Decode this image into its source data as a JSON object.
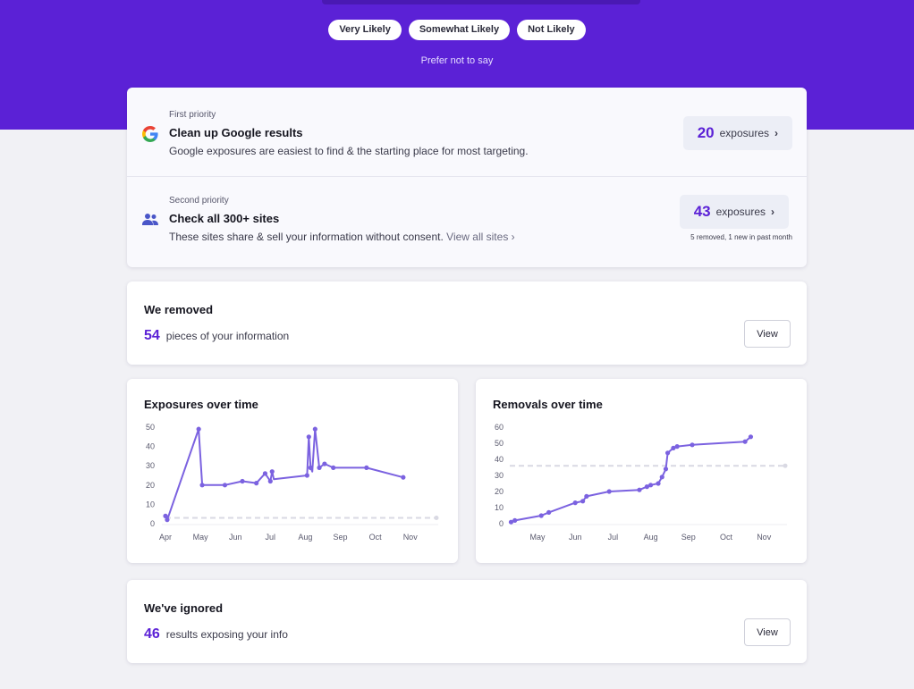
{
  "hero": {
    "options": [
      "Very Likely",
      "Somewhat Likely",
      "Not Likely"
    ],
    "prefer_not": "Prefer not to say"
  },
  "priorities": [
    {
      "label": "First priority",
      "title": "Clean up Google results",
      "description": "Google exposures are easiest to find & the starting place for most targeting.",
      "count": "20",
      "count_label": "exposures",
      "icon": "google-icon"
    },
    {
      "label": "Second priority",
      "title": "Check all 300+ sites",
      "description": "These sites share & sell your information without consent.",
      "link": "View all sites ›",
      "count": "43",
      "count_label": "exposures",
      "note": "5 removed, 1 new in past month",
      "icon": "people-icon"
    }
  ],
  "removed": {
    "title": "We removed",
    "count": "54",
    "text": "pieces of your information",
    "button": "View"
  },
  "ignored": {
    "title": "We've ignored",
    "count": "46",
    "text": "results exposing your info",
    "button": "View"
  },
  "colors": {
    "accent": "#5b21d6",
    "line": "#7b62e0",
    "reference": "#d9d9e3"
  },
  "chart_data": [
    {
      "type": "line",
      "title": "Exposures over time",
      "ylim": [
        0,
        50
      ],
      "yticks": [
        "0",
        "10",
        "20",
        "30",
        "40",
        "50"
      ],
      "months": [
        "Apr",
        "May",
        "Jun",
        "Jul",
        "Aug",
        "Sep",
        "Oct",
        "Nov"
      ],
      "reference_line": 3,
      "points": [
        [
          0,
          4
        ],
        [
          0.05,
          2
        ],
        [
          0.95,
          49
        ],
        [
          1.05,
          20
        ],
        [
          1.7,
          20
        ],
        [
          2.2,
          22
        ],
        [
          2.6,
          21
        ],
        [
          2.85,
          26
        ],
        [
          3.0,
          22
        ],
        [
          3.05,
          27
        ],
        [
          3.1,
          23
        ],
        [
          4.05,
          25
        ],
        [
          4.1,
          45
        ],
        [
          4.15,
          29
        ],
        [
          4.2,
          27
        ],
        [
          4.28,
          49
        ],
        [
          4.4,
          29
        ],
        [
          4.55,
          31
        ],
        [
          4.8,
          29
        ],
        [
          5.75,
          29
        ],
        [
          6.8,
          24
        ]
      ],
      "markers": [
        [
          0,
          4
        ],
        [
          0.05,
          2
        ],
        [
          0.95,
          49
        ],
        [
          1.05,
          20
        ],
        [
          1.7,
          20
        ],
        [
          2.2,
          22
        ],
        [
          2.6,
          21
        ],
        [
          2.85,
          26
        ],
        [
          3.0,
          22
        ],
        [
          3.05,
          27
        ],
        [
          4.05,
          25
        ],
        [
          4.1,
          45
        ],
        [
          4.15,
          29
        ],
        [
          4.28,
          49
        ],
        [
          4.4,
          29
        ],
        [
          4.55,
          31
        ],
        [
          4.8,
          29
        ],
        [
          5.75,
          29
        ],
        [
          6.8,
          24
        ]
      ]
    },
    {
      "type": "line",
      "title": "Removals over time",
      "ylim": [
        0,
        60
      ],
      "yticks": [
        "0",
        "10",
        "20",
        "30",
        "40",
        "50",
        "60"
      ],
      "months": [
        "May",
        "Jun",
        "Jul",
        "Aug",
        "Sep",
        "Oct",
        "Nov"
      ],
      "reference_line": 36,
      "points": [
        [
          -0.7,
          1
        ],
        [
          -0.6,
          2
        ],
        [
          0.1,
          5
        ],
        [
          0.2,
          6
        ],
        [
          0.3,
          7
        ],
        [
          1.0,
          13
        ],
        [
          1.2,
          14
        ],
        [
          1.3,
          17
        ],
        [
          1.9,
          20
        ],
        [
          2.7,
          21
        ],
        [
          2.9,
          23
        ],
        [
          3.0,
          24
        ],
        [
          3.2,
          25
        ],
        [
          3.3,
          29
        ],
        [
          3.4,
          34
        ],
        [
          3.45,
          44
        ],
        [
          3.6,
          47
        ],
        [
          3.7,
          48
        ],
        [
          4.1,
          49
        ],
        [
          5.5,
          51
        ],
        [
          5.65,
          54
        ]
      ],
      "markers": [
        [
          -0.7,
          1
        ],
        [
          -0.6,
          2
        ],
        [
          0.1,
          5
        ],
        [
          0.3,
          7
        ],
        [
          1.0,
          13
        ],
        [
          1.2,
          14
        ],
        [
          1.3,
          17
        ],
        [
          1.9,
          20
        ],
        [
          2.7,
          21
        ],
        [
          2.9,
          23
        ],
        [
          3.0,
          24
        ],
        [
          3.2,
          25
        ],
        [
          3.3,
          29
        ],
        [
          3.4,
          34
        ],
        [
          3.45,
          44
        ],
        [
          3.6,
          47
        ],
        [
          3.7,
          48
        ],
        [
          4.1,
          49
        ],
        [
          5.5,
          51
        ],
        [
          5.65,
          54
        ]
      ]
    }
  ]
}
